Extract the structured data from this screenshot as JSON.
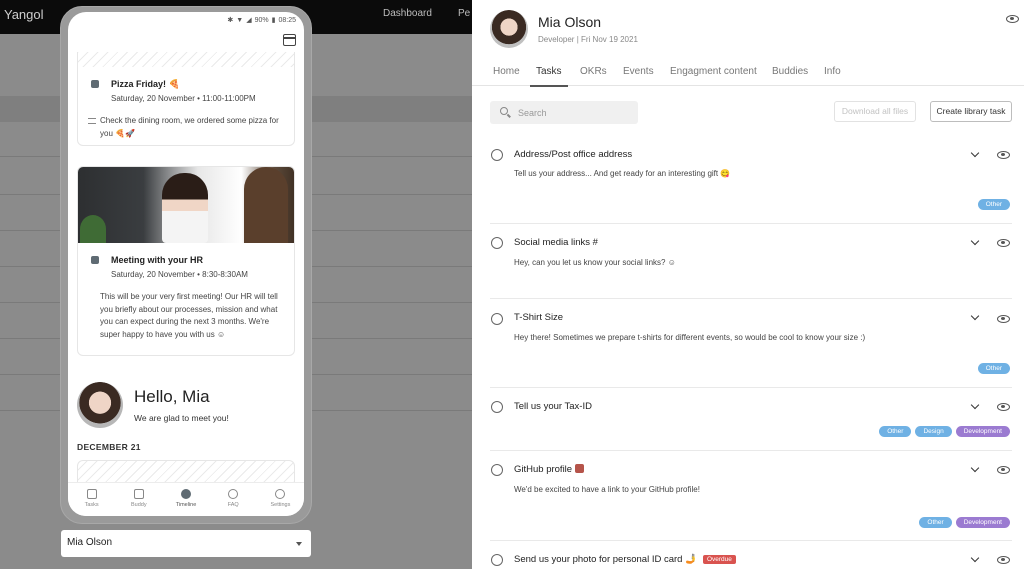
{
  "background": {
    "brand": "Yangol",
    "nav": [
      "Dashboard",
      "Pe"
    ]
  },
  "phone": {
    "status": {
      "battery": "90%",
      "time": "08:25"
    },
    "events": [
      {
        "title": "Pizza Friday! 🍕",
        "date": "Saturday, 20 November • 11:00-11:00PM",
        "description": "Check the dining room, we ordered some pizza for you 🍕🚀"
      },
      {
        "title": "Meeting with your HR",
        "date": "Saturday, 20 November • 8:30-8:30AM",
        "description": "This will be your very first meeting! Our HR will tell you briefly about our processes, mission and what you can expect during the next 3 months. We're super happy to have you with us ☺"
      }
    ],
    "hello": {
      "title": "Hello, Mia",
      "subtitle": "We are glad to meet you!"
    },
    "month_label": "DECEMBER 21",
    "tabbar": [
      "Tasks",
      "Buddy",
      "Timeline",
      "FAQ",
      "Settings"
    ],
    "active_tab": "Timeline"
  },
  "user_select": {
    "value": "Mia Olson"
  },
  "panel": {
    "name": "Mia Olson",
    "subtitle": "Developer | Fri Nov 19 2021",
    "tabs": [
      "Home",
      "Tasks",
      "OKRs",
      "Events",
      "Engagment content",
      "Buddies",
      "Info"
    ],
    "active_tab": "Tasks",
    "search_placeholder": "Search",
    "download_label": "Download all files",
    "create_label": "Create library task",
    "tasks": [
      {
        "title": "Address/Post office address",
        "description": "Tell us your address... And get ready for an interesting gift 😋",
        "tags": [
          "Other"
        ]
      },
      {
        "title": "Social media links #",
        "description": "Hey, can you let us know your social links? ☺",
        "tags": []
      },
      {
        "title": "T-Shirt Size",
        "description": "Hey there! Sometimes we prepare t-shirts for different events, so would be cool to know your size :)",
        "tags": [
          "Other"
        ]
      },
      {
        "title": "Tell us your Tax-ID",
        "description": "",
        "tags": [
          "Other",
          "Design",
          "Development"
        ]
      },
      {
        "title": "GitHub profile",
        "description": "We'd be excited to have a link to your GitHub profile!",
        "tags": [
          "Other",
          "Development"
        ]
      },
      {
        "title": "Send us your photo for personal ID card 🤳",
        "description": "",
        "tags": [],
        "badge": "Overdue"
      }
    ]
  },
  "colors": {
    "tag_blue": "#6fb1e4",
    "tag_purple": "#9b7bd1",
    "overdue_red": "#d9534f"
  }
}
